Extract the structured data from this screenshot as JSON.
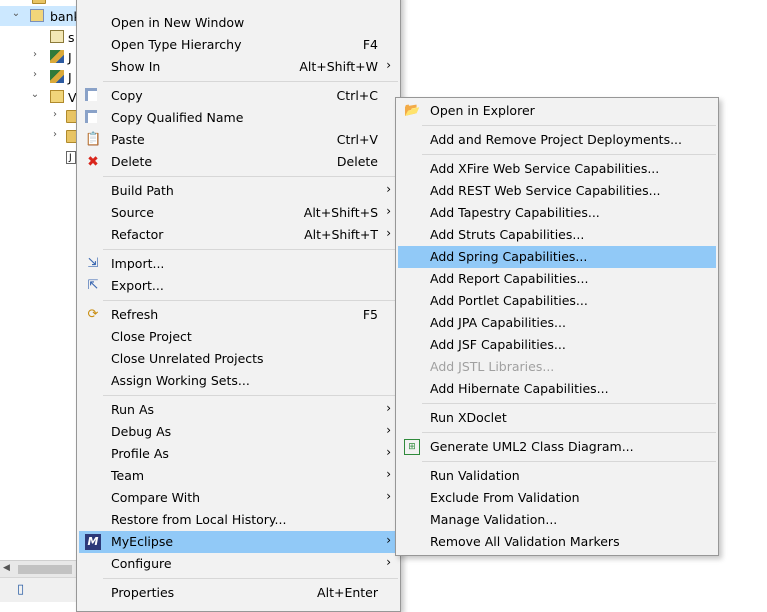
{
  "tree": {
    "rows": [
      {
        "twisty": "",
        "label": "bank"
      },
      {
        "twisty": "",
        "label": "s"
      },
      {
        "twisty": "›",
        "label": "J"
      },
      {
        "twisty": "›",
        "label": "J"
      },
      {
        "twisty": "⌄",
        "label": "V"
      },
      {
        "twisty": "›",
        "label": ""
      },
      {
        "twisty": "›",
        "label": ""
      },
      {
        "twisty": "",
        "label": "J"
      }
    ]
  },
  "context_menu": {
    "items": [
      {
        "label": "Open in New Window",
        "shortcut": "",
        "submenu": false
      },
      {
        "label": "Open Type Hierarchy",
        "shortcut": "F4",
        "submenu": false
      },
      {
        "label": "Show In",
        "shortcut": "Alt+Shift+W",
        "submenu": true
      },
      {
        "label": "Copy",
        "shortcut": "Ctrl+C",
        "submenu": false
      },
      {
        "label": "Copy Qualified Name",
        "shortcut": "",
        "submenu": false
      },
      {
        "label": "Paste",
        "shortcut": "Ctrl+V",
        "submenu": false
      },
      {
        "label": "Delete",
        "shortcut": "Delete",
        "submenu": false
      },
      {
        "label": "Build Path",
        "shortcut": "",
        "submenu": true
      },
      {
        "label": "Source",
        "shortcut": "Alt+Shift+S",
        "submenu": true
      },
      {
        "label": "Refactor",
        "shortcut": "Alt+Shift+T",
        "submenu": true
      },
      {
        "label": "Import...",
        "shortcut": "",
        "submenu": false
      },
      {
        "label": "Export...",
        "shortcut": "",
        "submenu": false
      },
      {
        "label": "Refresh",
        "shortcut": "F5",
        "submenu": false
      },
      {
        "label": "Close Project",
        "shortcut": "",
        "submenu": false
      },
      {
        "label": "Close Unrelated Projects",
        "shortcut": "",
        "submenu": false
      },
      {
        "label": "Assign Working Sets...",
        "shortcut": "",
        "submenu": false
      },
      {
        "label": "Run As",
        "shortcut": "",
        "submenu": true
      },
      {
        "label": "Debug As",
        "shortcut": "",
        "submenu": true
      },
      {
        "label": "Profile As",
        "shortcut": "",
        "submenu": true
      },
      {
        "label": "Team",
        "shortcut": "",
        "submenu": true
      },
      {
        "label": "Compare With",
        "shortcut": "",
        "submenu": true
      },
      {
        "label": "Restore from Local History...",
        "shortcut": "",
        "submenu": false
      },
      {
        "label": "MyEclipse",
        "shortcut": "",
        "submenu": true
      },
      {
        "label": "Configure",
        "shortcut": "",
        "submenu": true
      },
      {
        "label": "Properties",
        "shortcut": "Alt+Enter",
        "submenu": false
      }
    ]
  },
  "submenu": {
    "items": [
      {
        "label": "Open in Explorer"
      },
      {
        "label": "Add and Remove Project Deployments..."
      },
      {
        "label": "Add XFire Web Service Capabilities..."
      },
      {
        "label": "Add REST Web Service Capabilities..."
      },
      {
        "label": "Add Tapestry Capabilities..."
      },
      {
        "label": "Add Struts Capabilities..."
      },
      {
        "label": "Add Spring Capabilities..."
      },
      {
        "label": "Add Report Capabilities..."
      },
      {
        "label": "Add Portlet Capabilities..."
      },
      {
        "label": "Add JPA Capabilities..."
      },
      {
        "label": "Add JSF Capabilities..."
      },
      {
        "label": "Add JSTL Libraries..."
      },
      {
        "label": "Add Hibernate Capabilities..."
      },
      {
        "label": "Run XDoclet"
      },
      {
        "label": "Generate UML2 Class Diagram..."
      },
      {
        "label": "Run Validation"
      },
      {
        "label": "Exclude From Validation"
      },
      {
        "label": "Manage Validation..."
      },
      {
        "label": "Remove All Validation Markers"
      }
    ]
  },
  "icons": {
    "copy": "copy-icon",
    "copy_qualified": "copy-qualified-icon",
    "paste": "paste-icon",
    "delete": "delete-icon",
    "import": "import-icon",
    "export": "export-icon",
    "refresh": "refresh-icon",
    "myeclipse": "myeclipse-icon",
    "explorer": "open-explorer-icon",
    "uml": "uml-diagram-icon"
  },
  "colors": {
    "highlight": "#91c9f7",
    "menu_bg": "#f2f2f2",
    "disabled_text": "#a0a0a0"
  }
}
